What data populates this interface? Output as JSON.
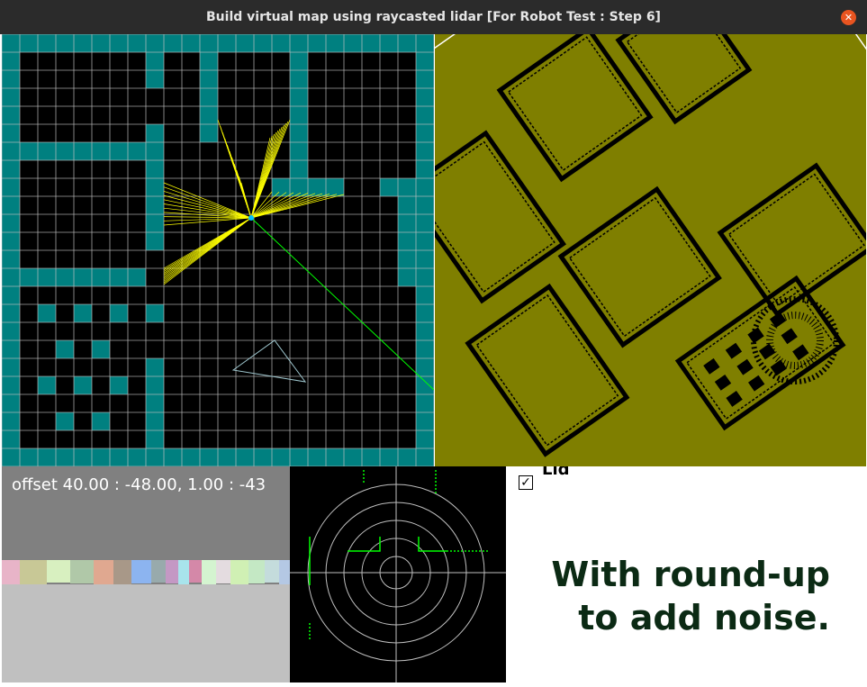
{
  "window": {
    "title": "Build virtual map using raycasted lidar [For Robot Test : Step 6]",
    "close_icon": "close-icon"
  },
  "grid_view": {
    "wall_color": "#008080",
    "floor_color": "#000000",
    "grid_line_color": "#c0c0c0",
    "ray_color": "#ffff00",
    "heading_color": "#00ff00",
    "robot_color": "#00bfff",
    "target_color": "#a0c8d0"
  },
  "map_view": {
    "background_color": "#7f7f00",
    "obstacle_color": "#000000",
    "border_color": "#ffffff"
  },
  "camera_view": {
    "offset_text": "offset 40.00 : -48.00, 1.00 : -43",
    "sky_color": "#808080",
    "ground_color": "#c0c0c0"
  },
  "radar_view": {
    "background_color": "#000000",
    "ring_color": "#bfbfbf",
    "hit_color": "#00ff00"
  },
  "options": {
    "checkbox_checked": true,
    "checkbox_label": "Lid",
    "note_line1": "With round-up",
    "note_line2": "to add noise."
  }
}
